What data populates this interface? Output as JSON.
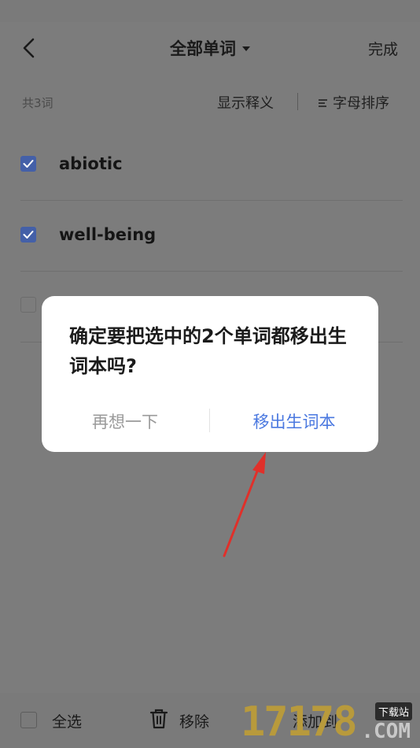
{
  "header": {
    "title": "全部单词",
    "done_label": "完成"
  },
  "toolbar": {
    "count": "共3词",
    "show_definition": "显示释义",
    "sort": "字母排序"
  },
  "words": [
    {
      "word": "abiotic",
      "checked": true
    },
    {
      "word": "well-being",
      "checked": true
    },
    {
      "word": "",
      "checked": false
    }
  ],
  "bottom": {
    "select_all": "全选",
    "remove": "移除",
    "add_to": "添加到"
  },
  "dialog": {
    "message": "确定要把选中的2个单词都移出生词本吗?",
    "cancel": "再想一下",
    "confirm": "移出生词本"
  },
  "watermark": {
    "number": "17178",
    "badge": "下载站",
    "domain": ".COM"
  },
  "colors": {
    "accent": "#4a78e0",
    "checkbox": "#4460a8",
    "annotation_arrow": "#e0302a"
  }
}
